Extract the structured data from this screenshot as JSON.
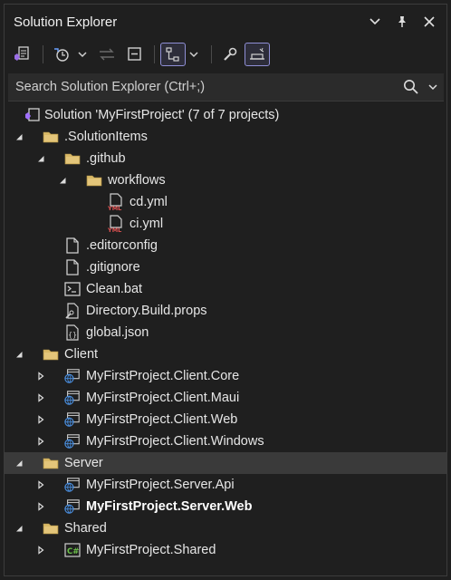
{
  "window": {
    "title": "Solution Explorer"
  },
  "search": {
    "placeholder": "Search Solution Explorer (Ctrl+;)"
  },
  "toolbar": [
    "vs-solution-icon",
    "history-icon",
    "chevron-down-icon",
    "sync-icon",
    "collapse-all-icon",
    "show-all-files-icon",
    "chevron-down-icon",
    "properties-wrench-icon",
    "preview-icon"
  ],
  "tree": [
    {
      "label": "Solution 'MyFirstProject' (7 of 7 projects)",
      "level": 0,
      "icon": "solution",
      "expander": "none"
    },
    {
      "label": ".SolutionItems",
      "level": 0,
      "icon": "folder",
      "expander": "expanded"
    },
    {
      "label": ".github",
      "level": 1,
      "icon": "folder",
      "expander": "expanded"
    },
    {
      "label": "workflows",
      "level": 2,
      "icon": "folder",
      "expander": "expanded"
    },
    {
      "label": "cd.yml",
      "level": 3,
      "icon": "yml",
      "expander": "none"
    },
    {
      "label": "ci.yml",
      "level": 3,
      "icon": "yml",
      "expander": "none"
    },
    {
      "label": ".editorconfig",
      "level": 1,
      "icon": "file",
      "expander": "none"
    },
    {
      "label": ".gitignore",
      "level": 1,
      "icon": "file",
      "expander": "none"
    },
    {
      "label": "Clean.bat",
      "level": 1,
      "icon": "bat",
      "expander": "none"
    },
    {
      "label": "Directory.Build.props",
      "level": 1,
      "icon": "props",
      "expander": "none"
    },
    {
      "label": "global.json",
      "level": 1,
      "icon": "json",
      "expander": "none"
    },
    {
      "label": "Client",
      "level": 0,
      "icon": "folder",
      "expander": "expanded"
    },
    {
      "label": "MyFirstProject.Client.Core",
      "level": 1,
      "icon": "web",
      "expander": "collapsed"
    },
    {
      "label": "MyFirstProject.Client.Maui",
      "level": 1,
      "icon": "web",
      "expander": "collapsed"
    },
    {
      "label": "MyFirstProject.Client.Web",
      "level": 1,
      "icon": "web",
      "expander": "collapsed"
    },
    {
      "label": "MyFirstProject.Client.Windows",
      "level": 1,
      "icon": "web",
      "expander": "collapsed"
    },
    {
      "label": "Server",
      "level": 0,
      "icon": "folder",
      "expander": "expanded",
      "selected": true
    },
    {
      "label": "MyFirstProject.Server.Api",
      "level": 1,
      "icon": "web",
      "expander": "collapsed"
    },
    {
      "label": "MyFirstProject.Server.Web",
      "level": 1,
      "icon": "web",
      "expander": "collapsed",
      "bold": true
    },
    {
      "label": "Shared",
      "level": 0,
      "icon": "folder",
      "expander": "expanded"
    },
    {
      "label": "MyFirstProject.Shared",
      "level": 1,
      "icon": "csharp",
      "expander": "collapsed"
    }
  ]
}
